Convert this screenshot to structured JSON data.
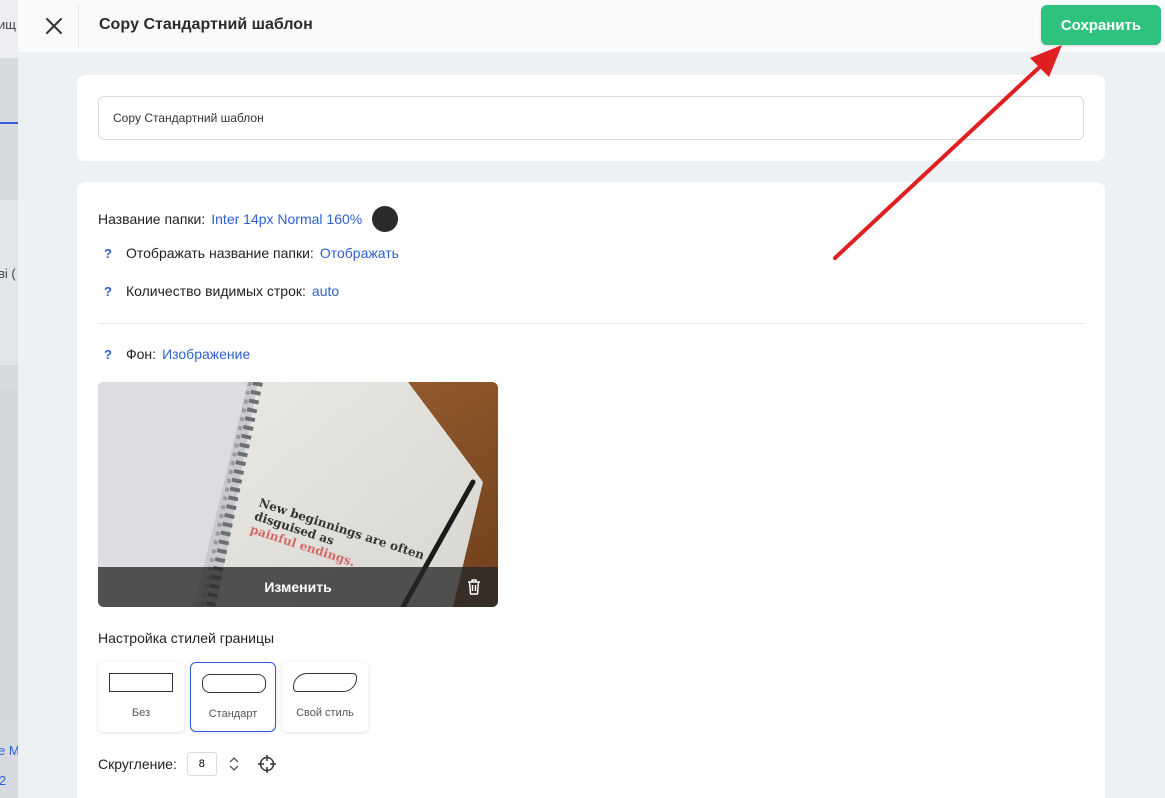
{
  "background_page": {
    "fragments": [
      "ищ",
      "ві (",
      "е М",
      "2"
    ]
  },
  "header": {
    "title": "Copy Стандартний шаблон",
    "save_label": "Сохранить"
  },
  "name_field": {
    "value": "Copy Стандартний шаблон"
  },
  "settings": {
    "folder_name_label": "Название папки:",
    "folder_name_style": "Inter 14px Normal 160%",
    "folder_name_color": "#2b2b2b",
    "show_folder_name_help": "?",
    "show_folder_name_label": "Отображать название папки:",
    "show_folder_name_value": "Отображать",
    "visible_rows_help": "?",
    "visible_rows_label": "Количество видимых строк:",
    "visible_rows_value": "auto",
    "background_help": "?",
    "background_label": "Фон:",
    "background_value": "Изображение"
  },
  "background_image": {
    "quote_line1": "New beginnings are often",
    "quote_line2": "disguised as",
    "quote_line3": "painful endings.",
    "change_label": "Изменить"
  },
  "border_styles": {
    "title": "Настройка стилей границы",
    "options": [
      {
        "label": "Без"
      },
      {
        "label": "Стандарт"
      },
      {
        "label": "Свой стиль"
      }
    ],
    "selected": "Стандарт"
  },
  "rounding": {
    "label": "Скругление:",
    "value": "8"
  },
  "colors": {
    "accent": "#2f5fd6",
    "save_button": "#2ec27e",
    "annotation_arrow": "#e02020"
  }
}
